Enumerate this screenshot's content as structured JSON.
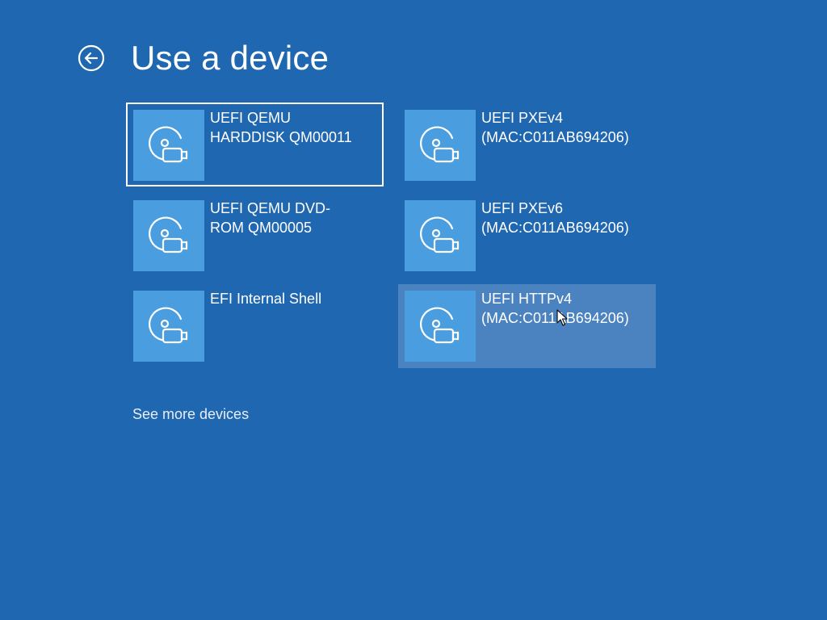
{
  "page": {
    "title": "Use a device",
    "background_color": "#2067b1"
  },
  "back_button": {
    "icon": "arrow-left-circle-icon"
  },
  "devices": [
    {
      "label": "UEFI QEMU\nHARDDISK QM00011",
      "icon": "removable-device-icon",
      "state": "selected"
    },
    {
      "label": "UEFI PXEv4\n(MAC:C011AB694206)",
      "icon": "removable-device-icon",
      "state": "normal"
    },
    {
      "label": "UEFI QEMU DVD-\nROM QM00005",
      "icon": "removable-device-icon",
      "state": "normal"
    },
    {
      "label": "UEFI PXEv6\n(MAC:C011AB694206)",
      "icon": "removable-device-icon",
      "state": "normal"
    },
    {
      "label": "EFI Internal Shell",
      "icon": "removable-device-icon",
      "state": "normal"
    },
    {
      "label": "UEFI HTTPv4\n(MAC:C011AB694206)",
      "icon": "removable-device-icon",
      "state": "hover"
    }
  ],
  "see_more": {
    "label": "See more devices"
  },
  "colors": {
    "tile_icon_background": "#4a9ee0",
    "hover_background": "#4a83c0",
    "selected_border": "#ffffff"
  }
}
